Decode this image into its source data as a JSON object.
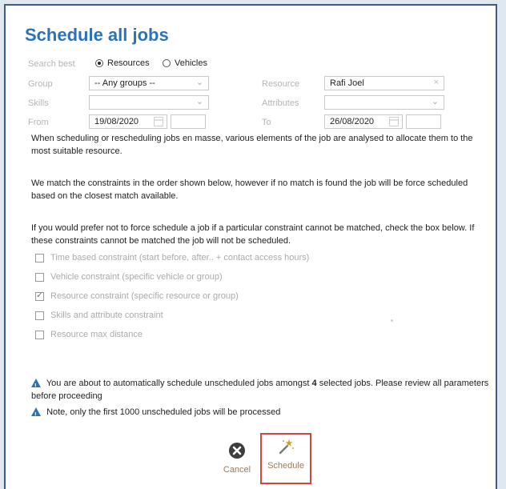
{
  "dialog": {
    "title": "Schedule all jobs",
    "search_best": {
      "label": "Search best",
      "options": [
        {
          "label": "Resources",
          "selected": true
        },
        {
          "label": "Vehicles",
          "selected": false
        }
      ]
    },
    "group": {
      "label": "Group",
      "value": "-- Any groups --"
    },
    "resource": {
      "label": "Resource",
      "value": "Rafi Joel"
    },
    "skills": {
      "label": "Skills",
      "value": ""
    },
    "attributes": {
      "label": "Attributes",
      "value": ""
    },
    "from": {
      "label": "From",
      "date": "19/08/2020",
      "time": ""
    },
    "to": {
      "label": "To",
      "date": "26/08/2020",
      "time": ""
    },
    "paragraphs": [
      "When scheduling or rescheduling jobs en masse, various elements of the job are analysed to allocate them to the most suitable resource.",
      "We match the constraints in the order shown below, however if no match is found the job will be force scheduled based on the closest match available.",
      "If you would prefer not to force schedule a job if a particular constraint cannot be matched, check the box below. If these constraints cannot be matched the job will not be scheduled."
    ],
    "constraints": [
      {
        "label": "Time based constraint (start before, after.. + contact access hours)",
        "checked": false
      },
      {
        "label": "Vehicle constraint (specific vehicle or group)",
        "checked": false
      },
      {
        "label": "Resource constraint (specific resource or group)",
        "checked": true
      },
      {
        "label": "Skills and attribute constraint",
        "checked": false
      },
      {
        "label": "Resource max distance",
        "checked": false
      }
    ],
    "notice": {
      "pre": "You are about to automatically schedule unscheduled jobs amongst ",
      "count": "4",
      "post": " selected jobs. Please review all parameters before proceeding",
      "note": "Note, only the first 1000 unscheduled jobs will be processed"
    },
    "buttons": {
      "cancel": "Cancel",
      "schedule": "Schedule"
    },
    "colors": {
      "title": "#2a73b7",
      "border": "#3b5d88",
      "highlight": "#d2453a"
    }
  }
}
